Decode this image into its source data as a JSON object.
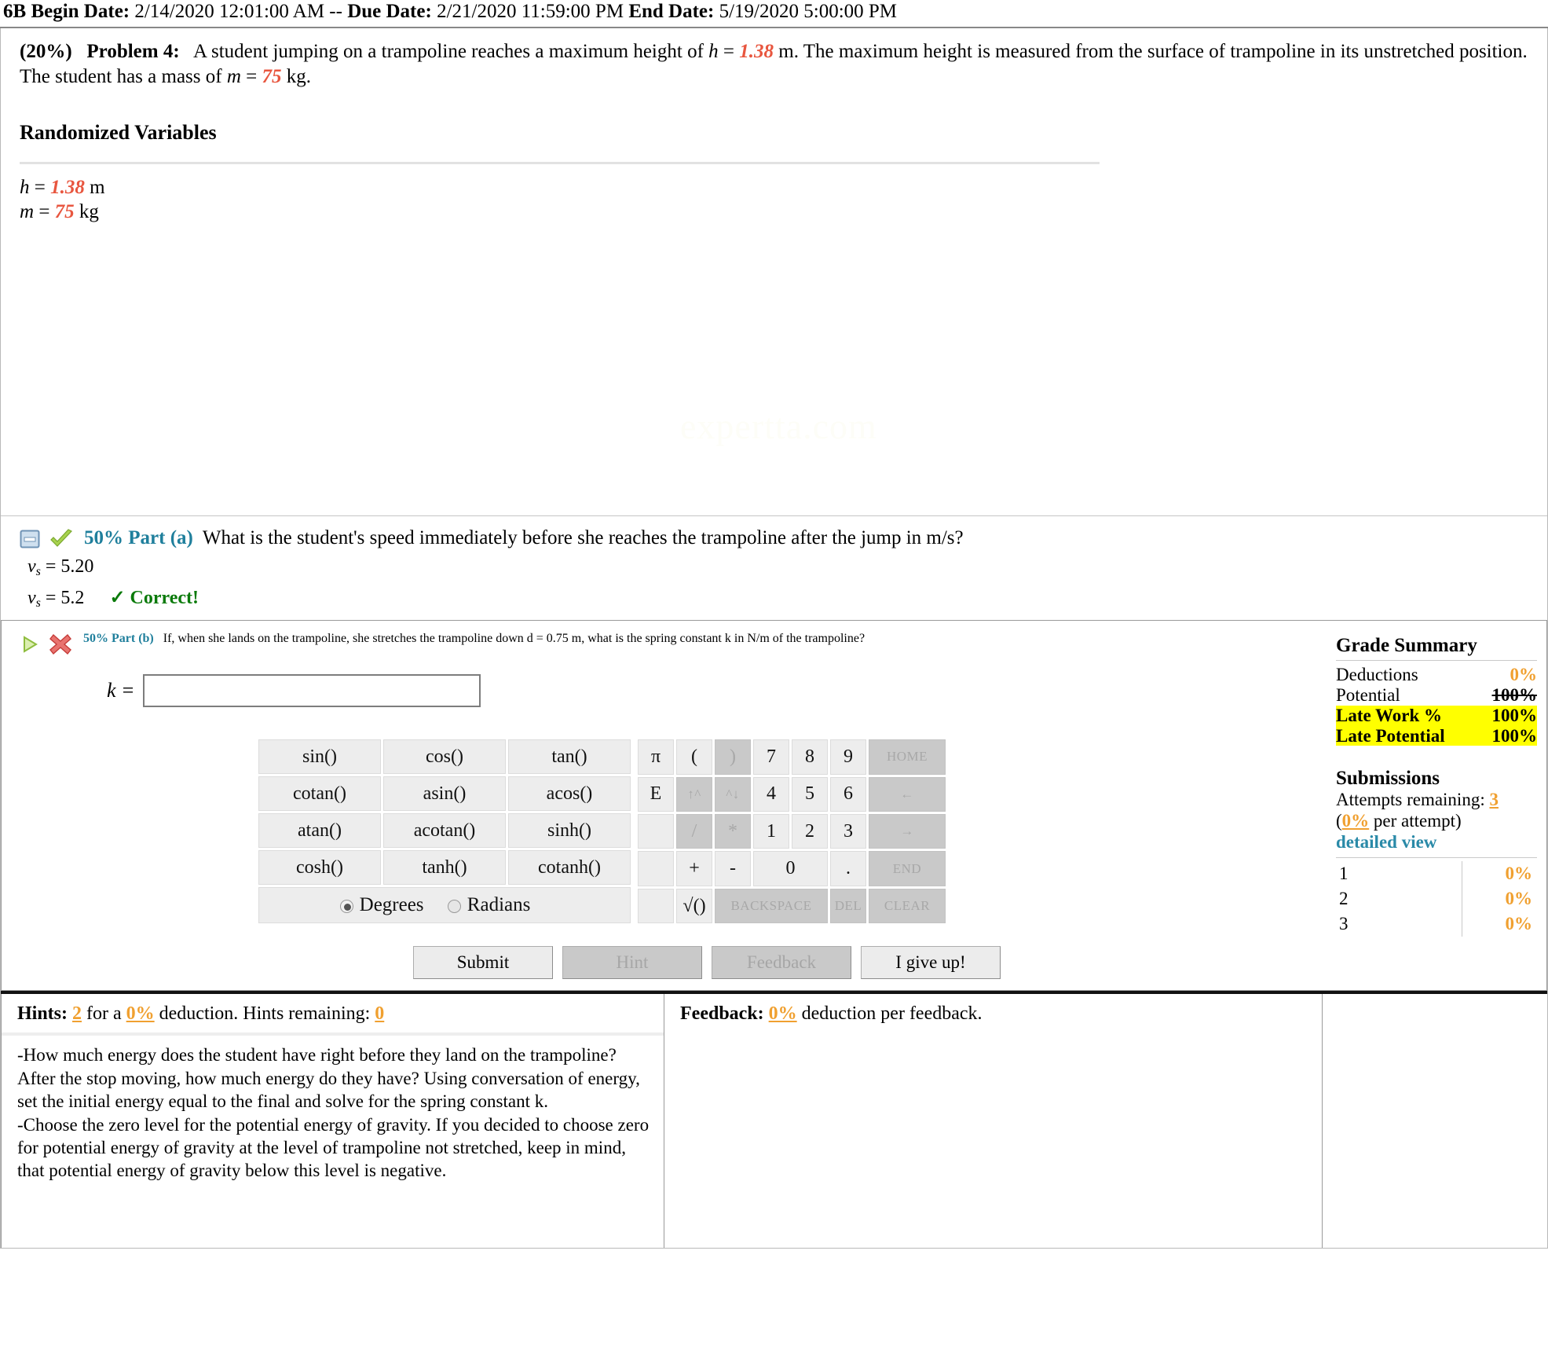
{
  "topbar": {
    "prefix": "6B",
    "begin_label": "Begin Date:",
    "begin_value": "2/14/2020 12:01:00 AM",
    "separator": "--",
    "due_label": "Due Date:",
    "due_value": "2/21/2020 11:59:00 PM",
    "end_label": "End Date:",
    "end_value": "5/19/2020 5:00:00 PM"
  },
  "problem": {
    "weight": "(20%)",
    "number": "Problem 4:",
    "text_1": "A student jumping on a trampoline reaches a maximum height of",
    "var_h_name": "h",
    "var_h_eq": "=",
    "var_h_value": "1.38",
    "text_2": "m. The maximum height is measured from the surface of trampoline in its unstretched position. The student has a mass of",
    "var_m_name": "m",
    "var_m_eq": "=",
    "var_m_value": "75",
    "text_3": "kg.",
    "randomized_title": "Randomized Variables",
    "randomized": [
      {
        "name": "h",
        "eq": "=",
        "value": "1.38",
        "unit": "m"
      },
      {
        "name": "m",
        "eq": "=",
        "value": "75",
        "unit": "kg"
      }
    ],
    "watermark": "expertta.com"
  },
  "part_a": {
    "weight_label": "50% Part (a)",
    "question": "What is the student's speed immediately before she reaches the trampoline after the jump in m/s?",
    "entered_var": "v",
    "entered_sub": "s",
    "entered_eq": "= 5.20",
    "graded_var": "v",
    "graded_sub": "s",
    "graded_eq": "= 5.2",
    "status": "✓ Correct!",
    "collapse_icon": "collapse-box-icon",
    "status_icon": "green-check-icon"
  },
  "part_b": {
    "weight_label": "50% Part (b)",
    "question": "If, when she lands on the trampoline, she stretches the trampoline down d = 0.75 m, what is the spring constant k in N/m of the trampoline?",
    "expand_icon": "green-play-icon",
    "status_icon": "red-x-icon",
    "answer_label": "k =",
    "answer_value": "",
    "answer_placeholder": ""
  },
  "calculator": {
    "functions": [
      [
        "sin()",
        "cos()",
        "tan()"
      ],
      [
        "cotan()",
        "asin()",
        "acos()"
      ],
      [
        "atan()",
        "acotan()",
        "sinh()"
      ],
      [
        "cosh()",
        "tanh()",
        "cotanh()"
      ]
    ],
    "consts": [
      "π",
      "E",
      "",
      "",
      ""
    ],
    "ops": [
      [
        "(",
        ")"
      ],
      [
        "↑^",
        "^↓"
      ],
      [
        "/",
        "*"
      ],
      [
        "+",
        "-"
      ],
      [
        "√()",
        ""
      ]
    ],
    "numbers": [
      [
        "7",
        "8",
        "9"
      ],
      [
        "4",
        "5",
        "6"
      ],
      [
        "1",
        "2",
        "3"
      ]
    ],
    "zero": "0",
    "dot": ".",
    "nav": [
      "HOME",
      "←",
      "→",
      "END"
    ],
    "bottom": [
      "BACKSPACE",
      "DEL",
      "CLEAR"
    ],
    "angle_mode": {
      "degrees_label": "Degrees",
      "radians_label": "Radians",
      "selected": "Degrees"
    }
  },
  "buttons": {
    "submit": "Submit",
    "hint": "Hint",
    "feedback": "Feedback",
    "give_up": "I give up!"
  },
  "grade_summary": {
    "title": "Grade Summary",
    "deductions_label": "Deductions",
    "deductions_value": "0%",
    "potential_label": "Potential",
    "potential_value": "100%",
    "late_work_label": "Late Work %",
    "late_work_value": "100%",
    "late_potential_label": "Late Potential",
    "late_potential_value": "100%"
  },
  "submissions": {
    "title": "Submissions",
    "attempts_label": "Attempts remaining:",
    "attempts_value": "3",
    "per_attempt_open": "(",
    "per_attempt_value": "0%",
    "per_attempt_text": " per attempt)",
    "detailed_view": "detailed view",
    "rows": [
      {
        "n": "1",
        "pct": "0%"
      },
      {
        "n": "2",
        "pct": "0%"
      },
      {
        "n": "3",
        "pct": "0%"
      }
    ]
  },
  "hints": {
    "label": "Hints:",
    "count": "2",
    "for_a": "for a",
    "deduction_pct": "0%",
    "deduction_text": "deduction. Hints remaining:",
    "remaining": "0",
    "body_1": "-How much energy does the student have right before they land on the trampoline? After the stop moving, how much energy do they have? Using conversation of energy, set the initial energy equal to the final and solve for the spring constant k.",
    "body_2": "-Choose the zero level for the potential energy of gravity. If you decided to choose zero for potential energy of gravity at the level of trampoline not stretched, keep in mind, that potential energy of gravity below this level is negative."
  },
  "feedback": {
    "label": "Feedback:",
    "pct": "0%",
    "text": "deduction per feedback.",
    "body": ""
  },
  "colors": {
    "accent_blue": "#1f7f9c",
    "orange": "#f0a030",
    "random_var": "#e8563f",
    "correct_green": "#0a7a0a",
    "highlight": "#ffff00"
  }
}
